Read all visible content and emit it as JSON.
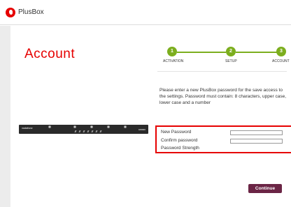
{
  "header": {
    "brand": "PlusBox",
    "logo_icon": "vodafone-speechmark-logo",
    "brand_color": "#e60000"
  },
  "page": {
    "title": "Account"
  },
  "steps": [
    {
      "number": "1",
      "label": "ACTIVATION"
    },
    {
      "number": "2",
      "label": "SETUP"
    },
    {
      "number": "3",
      "label": "ACCOUNT"
    }
  ],
  "step_color": "#7cae1e",
  "instructions": "Please enter a new PlusBox password for the save access to the settings. Password must contain: 8 characters, upper case, lower case and a number",
  "device": {
    "brand": "vodafone",
    "model": "GW800"
  },
  "form": {
    "new_password_label": "New Password",
    "new_password_value": "",
    "confirm_password_label": "Confirm password",
    "confirm_password_value": "",
    "strength_label": "Password Strength"
  },
  "actions": {
    "continue_label": "Continue",
    "continue_color": "#6b2545"
  }
}
